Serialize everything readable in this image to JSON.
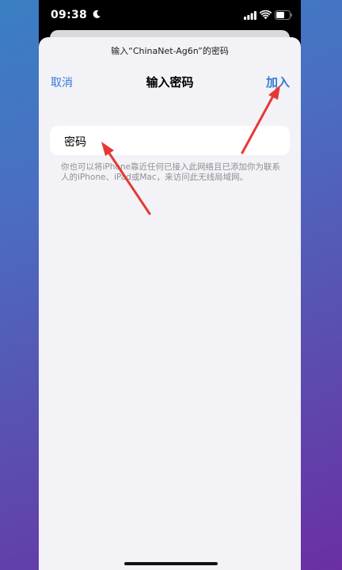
{
  "status_bar": {
    "time": "09:38",
    "icons": [
      "moon-icon",
      "signal-icon",
      "wifi-icon",
      "battery-icon"
    ]
  },
  "sheet": {
    "prompt": "输入“ChinaNet-Ag6n”的密码",
    "nav": {
      "cancel_label": "取消",
      "title": "输入密码",
      "join_label": "加入"
    },
    "password_field": {
      "label": "密码",
      "value": ""
    },
    "hint": "你也可以将iPhone靠近任何已接入此网络且已添加你为联系人的iPhone、iPad或Mac，来访问此无线局域网。"
  },
  "colors": {
    "accent": "#3478d8",
    "sheet_background": "#f2f2f7",
    "annotation_arrow": "#e53935"
  }
}
